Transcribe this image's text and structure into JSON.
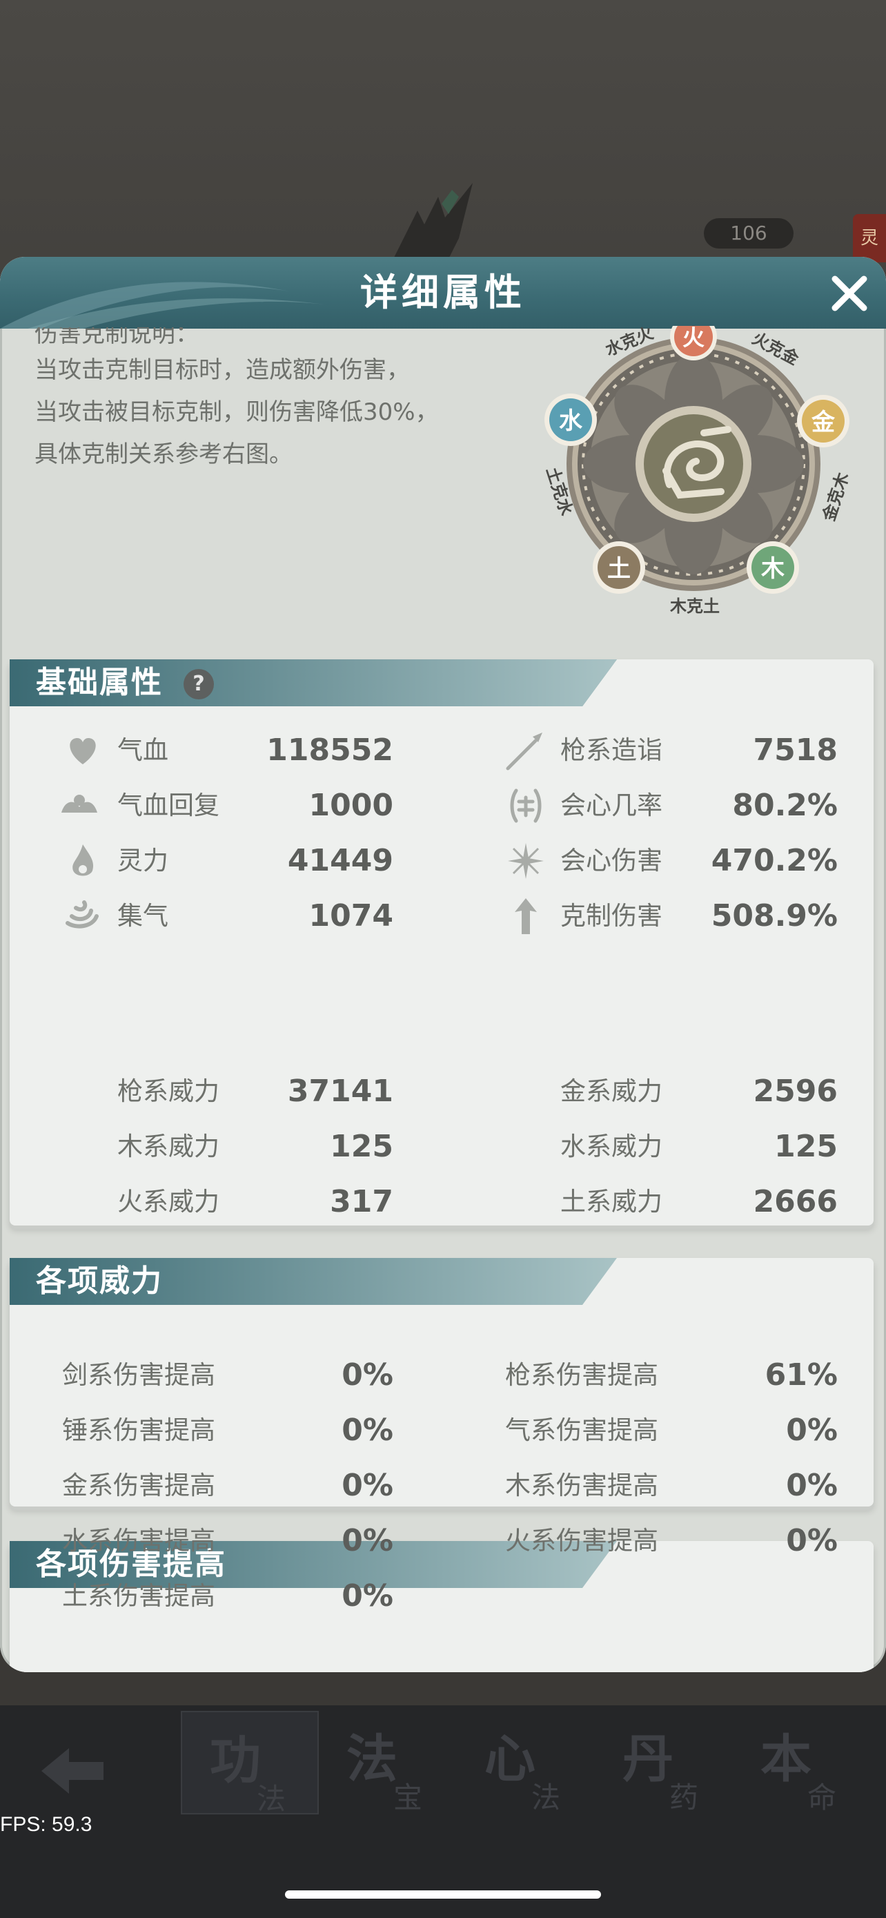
{
  "background": {
    "badge": "106",
    "side_tag": "灵"
  },
  "bottom_nav": {
    "tabs": [
      {
        "big": "功",
        "small": "法"
      },
      {
        "big": "法",
        "small": "宝"
      },
      {
        "big": "心",
        "small": "法"
      },
      {
        "big": "丹",
        "small": "药"
      },
      {
        "big": "本",
        "small": "命"
      }
    ]
  },
  "fps": "FPS: 59.3",
  "modal": {
    "title": "详细属性",
    "explain": {
      "heading": "伤害克制说明：",
      "line1": "当攻击克制目标时，造成额外伤害，",
      "line2": "当攻击被目标克制，则伤害降低30%，",
      "line3": "具体克制关系参考右图。"
    },
    "wheel": {
      "elements": {
        "fire": "火",
        "gold": "金",
        "wood": "木",
        "earth": "土",
        "water": "水"
      },
      "relations": {
        "water_fire": "水克火",
        "fire_gold": "火克金",
        "gold_wood": "金克木",
        "wood_earth": "木克土",
        "earth_water": "土克水"
      }
    },
    "basic": {
      "title": "基础属性",
      "help": "?",
      "left": [
        {
          "label": "气血",
          "value": "118552",
          "icon": "heart-icon"
        },
        {
          "label": "气血回复",
          "value": "1000",
          "icon": "heal-icon"
        },
        {
          "label": "灵力",
          "value": "41449",
          "icon": "flame-icon"
        },
        {
          "label": "集气",
          "value": "1074",
          "icon": "swirl-icon"
        }
      ],
      "right": [
        {
          "label": "枪系造诣",
          "value": "7518",
          "icon": "spear-icon"
        },
        {
          "label": "会心几率",
          "value": "80.2%",
          "icon": "crit-rate-icon"
        },
        {
          "label": "会心伤害",
          "value": "470.2%",
          "icon": "crit-damage-icon"
        },
        {
          "label": "克制伤害",
          "value": "508.9%",
          "icon": "counter-icon"
        }
      ]
    },
    "power": {
      "title": "各项威力",
      "left": [
        {
          "label": "枪系威力",
          "value": "37141"
        },
        {
          "label": "木系威力",
          "value": "125"
        },
        {
          "label": "火系威力",
          "value": "317"
        }
      ],
      "right": [
        {
          "label": "金系威力",
          "value": "2596"
        },
        {
          "label": "水系威力",
          "value": "125"
        },
        {
          "label": "土系威力",
          "value": "2666"
        }
      ]
    },
    "damage": {
      "title": "各项伤害提高",
      "left": [
        {
          "label": "剑系伤害提高",
          "value": "0%"
        },
        {
          "label": "锤系伤害提高",
          "value": "0%"
        },
        {
          "label": "金系伤害提高",
          "value": "0%"
        },
        {
          "label": "水系伤害提高",
          "value": "0%"
        },
        {
          "label": "土系伤害提高",
          "value": "0%"
        }
      ],
      "right": [
        {
          "label": "枪系伤害提高",
          "value": "61%"
        },
        {
          "label": "气系伤害提高",
          "value": "0%"
        },
        {
          "label": "木系伤害提高",
          "value": "0%"
        },
        {
          "label": "火系伤害提高",
          "value": "0%"
        }
      ]
    }
  },
  "colors": {
    "header": "#3b6a73",
    "modal_bg": "#d9dcd7",
    "card_bg": "#eef0ee",
    "label": "#6e716c",
    "value": "#5c5e5b"
  }
}
